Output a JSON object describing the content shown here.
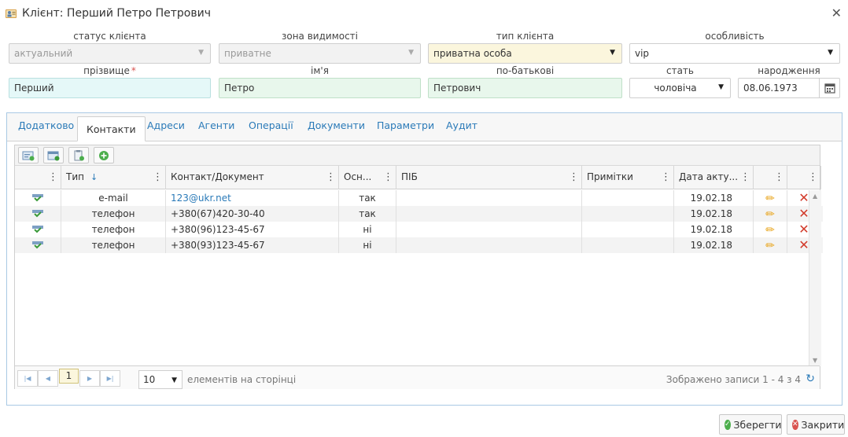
{
  "window": {
    "title": "Клієнт: Перший Петро Петрович"
  },
  "form": {
    "status": {
      "label": "статус клієнта",
      "value": "актуальний"
    },
    "zone": {
      "label": "зона видимості",
      "value": "приватне"
    },
    "type": {
      "label": "тип клієнта",
      "value": "приватна особа"
    },
    "feature": {
      "label": "особливість",
      "value": "vip"
    },
    "surname": {
      "label": "прізвище",
      "required_mark": "*",
      "value": "Перший"
    },
    "name": {
      "label": "ім'я",
      "value": "Петро"
    },
    "patronymic": {
      "label": "по-батькові",
      "value": "Петрович"
    },
    "sex": {
      "label": "стать",
      "value": "чоловіча"
    },
    "birth": {
      "label": "народження",
      "value": "08.06.1973"
    }
  },
  "tabs": [
    "Додатково",
    "Контакти",
    "Адреси",
    "Агенти",
    "Операції",
    "Документи",
    "Параметри",
    "Аудит"
  ],
  "active_tab": "Контакти",
  "table": {
    "columns": [
      "Тип",
      "Контакт/Документ",
      "Осн...",
      "ПІБ",
      "Примітки",
      "Дата акту..."
    ],
    "rows": [
      {
        "type": "e-mail",
        "contact": "123@ukr.net",
        "main": "так",
        "pib": "",
        "notes": "",
        "date": "19.02.18"
      },
      {
        "type": "телефон",
        "contact": "+380(67)420-30-40",
        "main": "так",
        "pib": "",
        "notes": "",
        "date": "19.02.18"
      },
      {
        "type": "телефон",
        "contact": "+380(96)123-45-67",
        "main": "ні",
        "pib": "",
        "notes": "",
        "date": "19.02.18"
      },
      {
        "type": "телефон",
        "contact": "+380(93)123-45-67",
        "main": "ні",
        "pib": "",
        "notes": "",
        "date": "19.02.18"
      }
    ]
  },
  "pager": {
    "current_page": "1",
    "page_size": "10",
    "per_page_label": "елементів на сторінці",
    "info": "Зображено записи 1 - 4 з 4"
  },
  "buttons": {
    "save": "Зберегти",
    "close": "Закрити"
  },
  "colors": {
    "link": "#2a7ab8",
    "panel_border": "#a9c9e4",
    "required": "#d9534f",
    "delete": "#d23a2a",
    "edit": "#e8a317"
  }
}
